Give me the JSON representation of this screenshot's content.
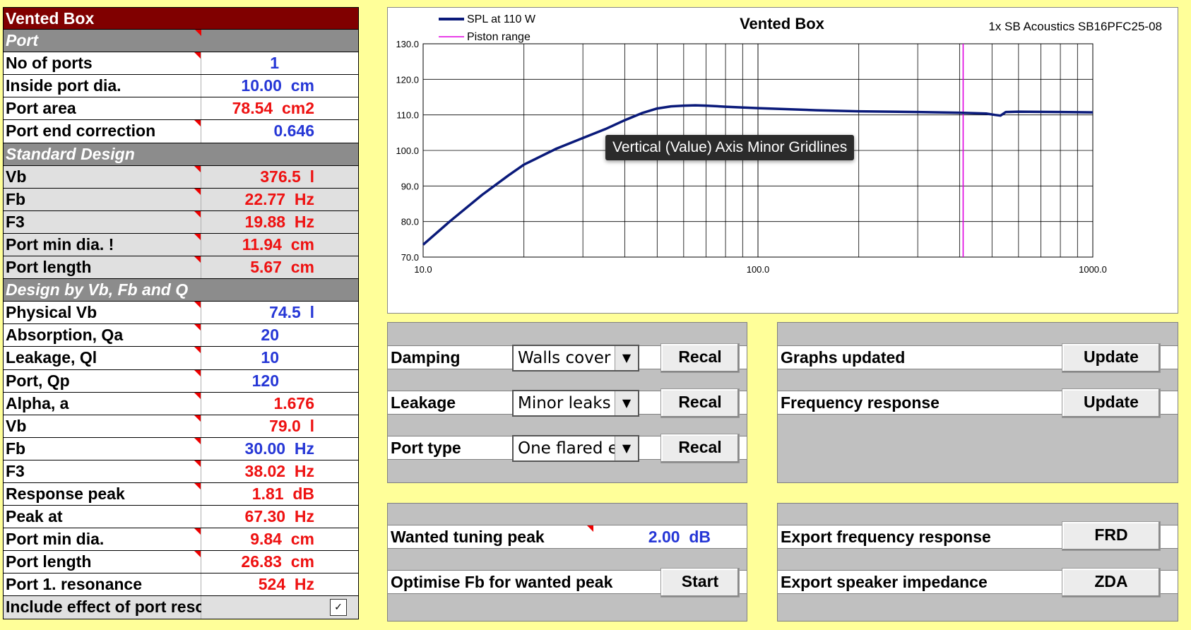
{
  "left_table": {
    "rows": [
      {
        "type": "title",
        "label": "Vented Box",
        "value": ""
      },
      {
        "type": "sect",
        "label": "Port",
        "value": "",
        "note": true
      },
      {
        "type": "white",
        "label": "No of ports",
        "value": "1",
        "color": "blue",
        "note": true,
        "center": true
      },
      {
        "type": "white",
        "label": "Inside port dia.",
        "value": "10.00  cm",
        "color": "blue"
      },
      {
        "type": "white",
        "label": "Port area",
        "value": "78.54  cm2",
        "color": "red"
      },
      {
        "type": "white",
        "label": "Port end correction",
        "value": "0.646",
        "color": "blue",
        "note": true
      },
      {
        "type": "sect",
        "label": "Standard Design",
        "value": ""
      },
      {
        "type": "grey",
        "label": "Vb",
        "value": "376.5  l",
        "color": "red",
        "note": true
      },
      {
        "type": "grey",
        "label": "Fb",
        "value": "22.77  Hz",
        "color": "red",
        "note": true
      },
      {
        "type": "grey",
        "label": "F3",
        "value": "19.88  Hz",
        "color": "red",
        "note": true
      },
      {
        "type": "grey",
        "label": "Port min dia. !",
        "value": "11.94  cm",
        "color": "red",
        "note": true
      },
      {
        "type": "grey",
        "label": "Port length",
        "value": "5.67  cm",
        "color": "red",
        "note": true
      },
      {
        "type": "sect",
        "label": "Design by Vb, Fb and Q",
        "value": ""
      },
      {
        "type": "white",
        "label": "Physical Vb",
        "value": "74.5  l",
        "color": "blue",
        "note": true
      },
      {
        "type": "white",
        "label": "Absorption, Qa",
        "value": "20",
        "color": "blue",
        "note": true,
        "center": true
      },
      {
        "type": "white",
        "label": "Leakage, Ql",
        "value": "10",
        "color": "blue",
        "note": true,
        "center": true
      },
      {
        "type": "white",
        "label": "Port, Qp",
        "value": "120",
        "color": "blue",
        "note": true,
        "center": true
      },
      {
        "type": "white",
        "label": "Alpha, a",
        "value": "1.676",
        "color": "red",
        "note": true
      },
      {
        "type": "white",
        "label": "Vb",
        "value": "79.0  l",
        "color": "red",
        "note": true
      },
      {
        "type": "white",
        "label": "Fb",
        "value": "30.00  Hz",
        "color": "blue",
        "note": true
      },
      {
        "type": "white",
        "label": "F3",
        "value": "38.02  Hz",
        "color": "red",
        "note": true
      },
      {
        "type": "white",
        "label": "Response peak",
        "value": "1.81  dB",
        "color": "red",
        "note": true
      },
      {
        "type": "white",
        "label": "Peak at",
        "value": "67.30  Hz",
        "color": "red"
      },
      {
        "type": "white",
        "label": "Port min dia.",
        "value": "9.84  cm",
        "color": "red",
        "note": true
      },
      {
        "type": "white",
        "label": "Port length",
        "value": "26.83  cm",
        "color": "red",
        "note": true
      },
      {
        "type": "white",
        "label": "Port 1. resonance",
        "value": "524  Hz",
        "color": "red"
      },
      {
        "type": "grey",
        "label": "Include effect of port resonance",
        "value": "",
        "checkbox": "✓"
      }
    ]
  },
  "chart_data": {
    "type": "line",
    "title": "Vented Box",
    "subtitle": "1x SB Acoustics SB16PFC25-08",
    "x_scale": "log",
    "xlim": [
      10,
      1000
    ],
    "ylim": [
      70,
      130
    ],
    "x_ticks": [
      "10.0",
      "100.0",
      "1000.0"
    ],
    "y_ticks": [
      "130.0",
      "120.0",
      "110.0",
      "100.0",
      "90.0",
      "80.0",
      "70.0"
    ],
    "legend_position": "top-left",
    "series": [
      {
        "name": "SPL at 110 W",
        "color": "#0a1a7a",
        "x": [
          10,
          12,
          15,
          18,
          20,
          25,
          30,
          35,
          40,
          45,
          50,
          55,
          60,
          65,
          70,
          80,
          100,
          150,
          200,
          300,
          400,
          480,
          510,
          530,
          550,
          600,
          800,
          1000
        ],
        "y": [
          73.5,
          80,
          87.5,
          93,
          96,
          100.5,
          103.5,
          106,
          108.5,
          110.5,
          111.8,
          112.4,
          112.6,
          112.7,
          112.6,
          112.3,
          111.9,
          111.3,
          111.0,
          110.8,
          110.6,
          110.4,
          110.0,
          109.8,
          110.8,
          110.9,
          110.8,
          110.7
        ]
      },
      {
        "name": "Piston range",
        "color": "#e000e0",
        "vertical_x": 410
      }
    ],
    "grid": true,
    "tooltip": "Vertical (Value) Axis Minor Gridlines"
  },
  "panel1": {
    "rows": [
      {
        "label": "Damping",
        "select": "Walls cover",
        "button": "Recal"
      },
      {
        "label": "Leakage",
        "select": "Minor leaks",
        "button": "Recal"
      },
      {
        "label": "Port type",
        "select": "One flared e",
        "button": "Recal"
      }
    ]
  },
  "panel2": {
    "rows": [
      {
        "label": "Graphs updated",
        "button": "Update"
      },
      {
        "label": "Frequency response",
        "button": "Update"
      }
    ]
  },
  "panel3": {
    "tuning_label": "Wanted tuning peak",
    "tuning_value": "2.00  dB",
    "optimise_label": "Optimise Fb for wanted peak",
    "start_button": "Start"
  },
  "panel4": {
    "frd_label": "Export frequency response",
    "frd_button": "FRD",
    "zda_label": "Export speaker impedance",
    "zda_button": "ZDA"
  }
}
